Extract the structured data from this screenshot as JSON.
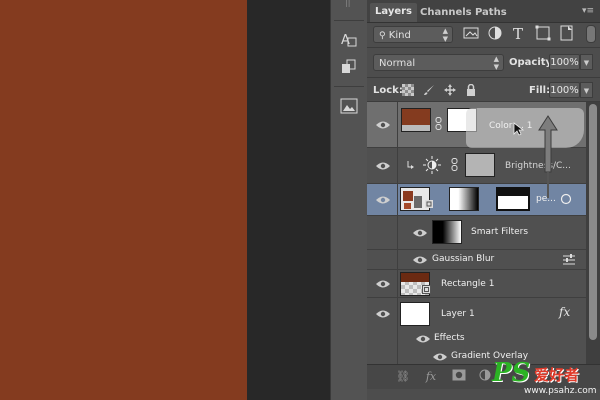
{
  "colors": {
    "canvas": "#843b1f",
    "panel": "#4d4d4d",
    "selected_blue": "#7185a3",
    "watermark": "#2bb324"
  },
  "tabs": [
    {
      "label": "Layers"
    },
    {
      "label": "Channels"
    },
    {
      "label": "Paths"
    }
  ],
  "filter": {
    "kind": "Kind",
    "icons": [
      "image-filter-icon",
      "adjustment-filter-icon",
      "type-filter-icon",
      "shape-filter-icon",
      "smart-object-filter-icon"
    ]
  },
  "blend": {
    "mode": "Normal",
    "opacity_label": "Opacity:",
    "opacity_value": "100%"
  },
  "lock": {
    "label": "Lock:",
    "fill_label": "Fill:",
    "fill_value": "100%"
  },
  "layers": [
    {
      "name": "Color ... 1",
      "type": "color-fill"
    },
    {
      "name": "Brightness/C...",
      "type": "adjustment"
    },
    {
      "name": "pe...",
      "type": "smart-object"
    },
    {
      "name": "Smart Filters",
      "type": "smart-filters"
    },
    {
      "name": "Gaussian Blur",
      "type": "filter"
    },
    {
      "name": "Rectangle 1",
      "type": "shape"
    },
    {
      "name": "Layer 1",
      "type": "pixel",
      "fx": "fx"
    },
    {
      "name": "Effects",
      "type": "effects"
    },
    {
      "name": "Gradient Overlay",
      "type": "effect"
    }
  ],
  "bottom_icons": [
    "link-icon",
    "fx-icon",
    "mask-icon",
    "adjustment-icon"
  ],
  "watermark": {
    "text_ps": "PS",
    "text_cn": "爱好者",
    "url": "www.psahz.com"
  }
}
